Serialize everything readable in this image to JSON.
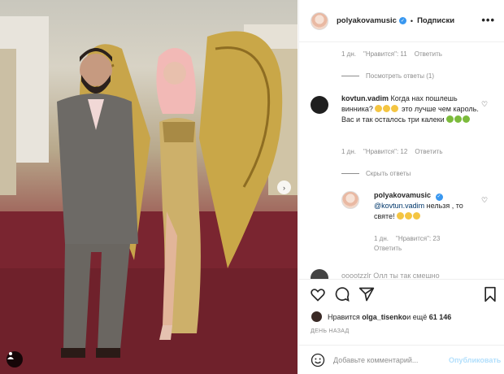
{
  "post": {
    "username": "polyakovamusic",
    "follow_label": "Подписки",
    "more_label": "•••",
    "dot": "•"
  },
  "comments": {
    "first_meta": {
      "time": "1 дн.",
      "likes": "\"Нравится\": 11",
      "reply": "Ответить"
    },
    "view_replies": "Посмотреть ответы (1)",
    "kovtun": {
      "username": "kovtun.vadim",
      "text_part1": "Когда нах пошлешь винника?",
      "text_part2": " это лучше чем кароль. Вас и так осталось три калеки ",
      "meta": {
        "time": "1 дн.",
        "likes": "\"Нравится\": 12",
        "reply": "Ответить"
      },
      "hide_replies": "Скрыть ответы"
    },
    "reply": {
      "username": "polyakovamusic",
      "mention": "@kovtun.vadim",
      "text": " нельзя , то святе!",
      "meta": {
        "time": "1 дн.",
        "likes": "\"Нравится\": 23",
        "reply": "Ответить"
      }
    },
    "partial": "ооооtzzlг Олл ты так смешно"
  },
  "actions": {
    "liked_by_prefix": "Нравится ",
    "liked_by_user": "olga_tisenko",
    "liked_by_and": " и ещё ",
    "likes_count": "61 146",
    "time_ago": "ДЕНЬ НАЗАД",
    "comment_placeholder": "Добавьте комментарий...",
    "publish_label": "Опубликовать"
  },
  "colors": {
    "accent": "#3897f0",
    "publish_disabled": "#b2dffc",
    "gold": "#c8a54a",
    "carpet": "#7a2530"
  }
}
